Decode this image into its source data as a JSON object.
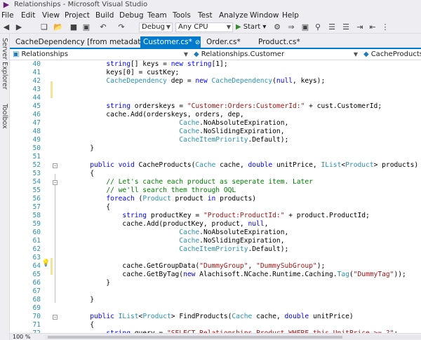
{
  "window": {
    "title": "Relationships - Microsoft Visual Studio"
  },
  "menu": [
    "File",
    "Edit",
    "View",
    "Project",
    "Build",
    "Debug",
    "Team",
    "Tools",
    "Test",
    "Analyze",
    "Window",
    "Help"
  ],
  "toolbar": {
    "configuration": "Debug",
    "platform": "Any CPU",
    "start_label": "Start"
  },
  "sidebar": {
    "tabs": [
      "Server Explorer",
      "Toolbox"
    ]
  },
  "tabs": [
    {
      "label": "CacheDependency [from metadata]",
      "active": false
    },
    {
      "label": "Customer.cs*",
      "active": true
    },
    {
      "label": "Order.cs*",
      "active": false
    },
    {
      "label": "Product.cs*",
      "active": false
    }
  ],
  "navbar": {
    "project": "Relationships",
    "class": "Relationships.Customer",
    "member": "CacheProducts(C"
  },
  "gutter": [
    "40",
    "41",
    "42",
    "43",
    "44",
    "45",
    "46",
    "47",
    "48",
    "49",
    "50",
    "51",
    "52",
    "53",
    "54",
    "55",
    "56",
    "57",
    "58",
    "59",
    "60",
    "61",
    "62",
    "63",
    "64",
    "65",
    "66",
    "67",
    "68",
    "69",
    "70",
    "71",
    "72"
  ],
  "code": [
    [
      [
        "",
        "            "
      ],
      [
        "kw",
        "string"
      ],
      [
        "",
        "[] keys = "
      ],
      [
        "kw",
        "new"
      ],
      [
        "",
        " "
      ],
      [
        "kw",
        "string"
      ],
      [
        "",
        "[1];"
      ]
    ],
    [
      [
        "",
        "            keys[0] = custKey;"
      ]
    ],
    [
      [
        "",
        "            "
      ],
      [
        "ty",
        "CacheDependency"
      ],
      [
        "",
        " dep = "
      ],
      [
        "kw",
        "new"
      ],
      [
        "",
        " "
      ],
      [
        "ty",
        "CacheDependency"
      ],
      [
        "",
        "("
      ],
      [
        "kw",
        "null"
      ],
      [
        "",
        ", keys);"
      ]
    ],
    [
      [
        "",
        ""
      ]
    ],
    [
      [
        "",
        ""
      ]
    ],
    [
      [
        "",
        "            "
      ],
      [
        "kw",
        "string"
      ],
      [
        "",
        " orderskeys = "
      ],
      [
        "st",
        "\"Customer:Orders:CustomerId:\""
      ],
      [
        "",
        " + cust.CustomerId;"
      ]
    ],
    [
      [
        "",
        "            cache.Add(orderskeys, orders, dep,"
      ]
    ],
    [
      [
        "",
        "                              "
      ],
      [
        "ty",
        "Cache"
      ],
      [
        "",
        ".NoAbsoluteExpiration,"
      ]
    ],
    [
      [
        "",
        "                              "
      ],
      [
        "ty",
        "Cache"
      ],
      [
        "",
        ".NoSlidingExpiration,"
      ]
    ],
    [
      [
        "",
        "                              "
      ],
      [
        "ty",
        "CacheItemPriority"
      ],
      [
        "",
        ".Default);"
      ]
    ],
    [
      [
        "",
        "        }"
      ]
    ],
    [
      [
        "",
        ""
      ]
    ],
    [
      [
        "",
        "        "
      ],
      [
        "kw",
        "public"
      ],
      [
        "",
        " "
      ],
      [
        "kw",
        "void"
      ],
      [
        "",
        " CacheProducts("
      ],
      [
        "ty",
        "Cache"
      ],
      [
        "",
        " cache, "
      ],
      [
        "kw",
        "double"
      ],
      [
        "",
        " unitPrice, "
      ],
      [
        "ty",
        "IList"
      ],
      [
        "",
        "<"
      ],
      [
        "ty",
        "Product"
      ],
      [
        "",
        "> products)"
      ]
    ],
    [
      [
        "",
        "        {"
      ]
    ],
    [
      [
        "",
        "            "
      ],
      [
        "cm",
        "// Let's cache each product as seperate item. Later"
      ]
    ],
    [
      [
        "",
        "            "
      ],
      [
        "cm",
        "// we'll search them through OQL"
      ]
    ],
    [
      [
        "",
        "            "
      ],
      [
        "kw",
        "foreach"
      ],
      [
        "",
        " ("
      ],
      [
        "ty",
        "Product"
      ],
      [
        "",
        " product "
      ],
      [
        "kw",
        "in"
      ],
      [
        "",
        " products)"
      ]
    ],
    [
      [
        "",
        "            {"
      ]
    ],
    [
      [
        "",
        "                "
      ],
      [
        "kw",
        "string"
      ],
      [
        "",
        " productKey = "
      ],
      [
        "st",
        "\"Product:ProductId:\""
      ],
      [
        "",
        " + product.ProductId;"
      ]
    ],
    [
      [
        "",
        "                cache.Add(productKey, product, "
      ],
      [
        "kw",
        "null"
      ],
      [
        "",
        ","
      ]
    ],
    [
      [
        "",
        "                              "
      ],
      [
        "ty",
        "Cache"
      ],
      [
        "",
        ".NoAbsoluteExpiration,"
      ]
    ],
    [
      [
        "",
        "                              "
      ],
      [
        "ty",
        "Cache"
      ],
      [
        "",
        ".NoSlidingExpiration,"
      ]
    ],
    [
      [
        "",
        "                              "
      ],
      [
        "ty",
        "CacheItemPriority"
      ],
      [
        "",
        ".Default);"
      ]
    ],
    [
      [
        "",
        ""
      ]
    ],
    [
      [
        "",
        "                cache.GetGroupData("
      ],
      [
        "st",
        "\"DummyGroup\""
      ],
      [
        "",
        ", "
      ],
      [
        "st",
        "\"DummySubGroup\""
      ],
      [
        "",
        ");"
      ]
    ],
    [
      [
        "",
        "                cache.GetByTag("
      ],
      [
        "kw",
        "new"
      ],
      [
        "",
        " Alachisoft.NCache.Runtime.Caching."
      ],
      [
        "ty",
        "Tag"
      ],
      [
        "",
        "("
      ],
      [
        "st",
        "\"DummyTag\""
      ],
      [
        "",
        "));"
      ]
    ],
    [
      [
        "",
        "            }"
      ]
    ],
    [
      [
        "",
        ""
      ]
    ],
    [
      [
        "",
        "        }"
      ]
    ],
    [
      [
        "",
        ""
      ]
    ],
    [
      [
        "",
        "        "
      ],
      [
        "kw",
        "public"
      ],
      [
        "",
        " "
      ],
      [
        "ty",
        "IList"
      ],
      [
        "",
        "<"
      ],
      [
        "ty",
        "Product"
      ],
      [
        "",
        "> FindProducts("
      ],
      [
        "ty",
        "Cache"
      ],
      [
        "",
        " cache, "
      ],
      [
        "kw",
        "double"
      ],
      [
        "",
        " unitPrice)"
      ]
    ],
    [
      [
        "",
        "        {"
      ]
    ],
    [
      [
        "",
        "            "
      ],
      [
        "kw",
        "string"
      ],
      [
        "",
        " query = "
      ],
      [
        "st",
        "\"SELECT Relationships.Product WHERE this.UnitPrice >= ?\""
      ],
      [
        "",
        ";"
      ]
    ]
  ],
  "statusbar": {
    "zoom": "100 %"
  },
  "icons": [
    "vs-logo-icon",
    "back-icon",
    "forward-icon",
    "new-project-icon",
    "open-icon",
    "save-icon",
    "save-all-icon",
    "undo-icon",
    "redo-icon",
    "play-icon",
    "lightbulb-icon"
  ]
}
